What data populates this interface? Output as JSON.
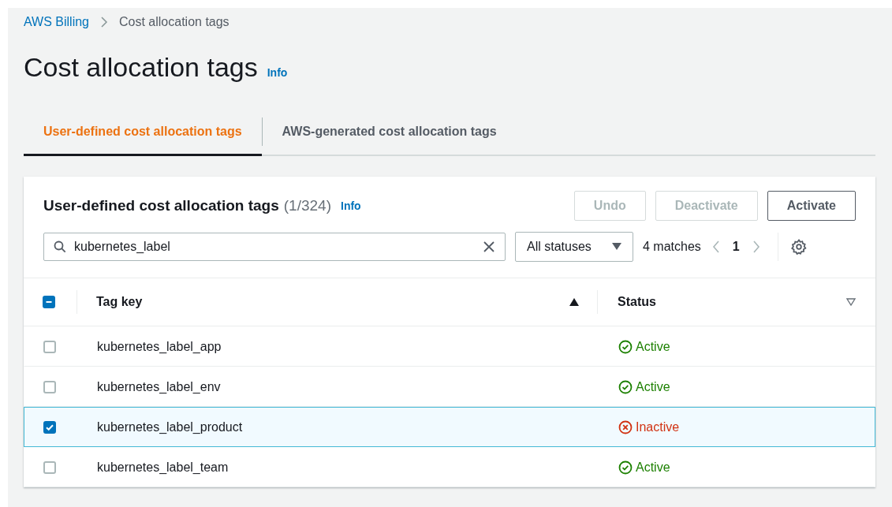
{
  "breadcrumb": [
    {
      "label": "AWS Billing",
      "link": true
    },
    {
      "label": "Cost allocation tags",
      "link": false
    }
  ],
  "title": "Cost allocation tags",
  "title_info": "Info",
  "tabs": [
    {
      "label": "User-defined cost allocation tags",
      "selected": true
    },
    {
      "label": "AWS-generated cost allocation tags",
      "selected": false
    }
  ],
  "panel": {
    "heading": "User-defined cost allocation tags",
    "count": "(1/324)",
    "info": "Info",
    "buttons": [
      {
        "label": "Undo",
        "disabled": true
      },
      {
        "label": "Deactivate",
        "disabled": true
      },
      {
        "label": "Activate",
        "disabled": false
      }
    ],
    "search": {
      "value": "kubernetes_label"
    },
    "filter": "All statuses",
    "matches": "4 matches",
    "page": "1",
    "select_all": {
      "indeterminate": true
    },
    "columns": [
      {
        "label": "Tag key",
        "sorted": true
      },
      {
        "label": "Status",
        "sorted": false
      }
    ],
    "rows": [
      {
        "tag_key": "kubernetes_label_app",
        "selected": false,
        "status": {
          "kind": "active",
          "label": "Active"
        }
      },
      {
        "tag_key": "kubernetes_label_env",
        "selected": false,
        "status": {
          "kind": "active",
          "label": "Active"
        }
      },
      {
        "tag_key": "kubernetes_label_product",
        "selected": true,
        "status": {
          "kind": "inactive",
          "label": "Inactive"
        }
      },
      {
        "tag_key": "kubernetes_label_team",
        "selected": false,
        "status": {
          "kind": "active",
          "label": "Active"
        }
      }
    ]
  }
}
